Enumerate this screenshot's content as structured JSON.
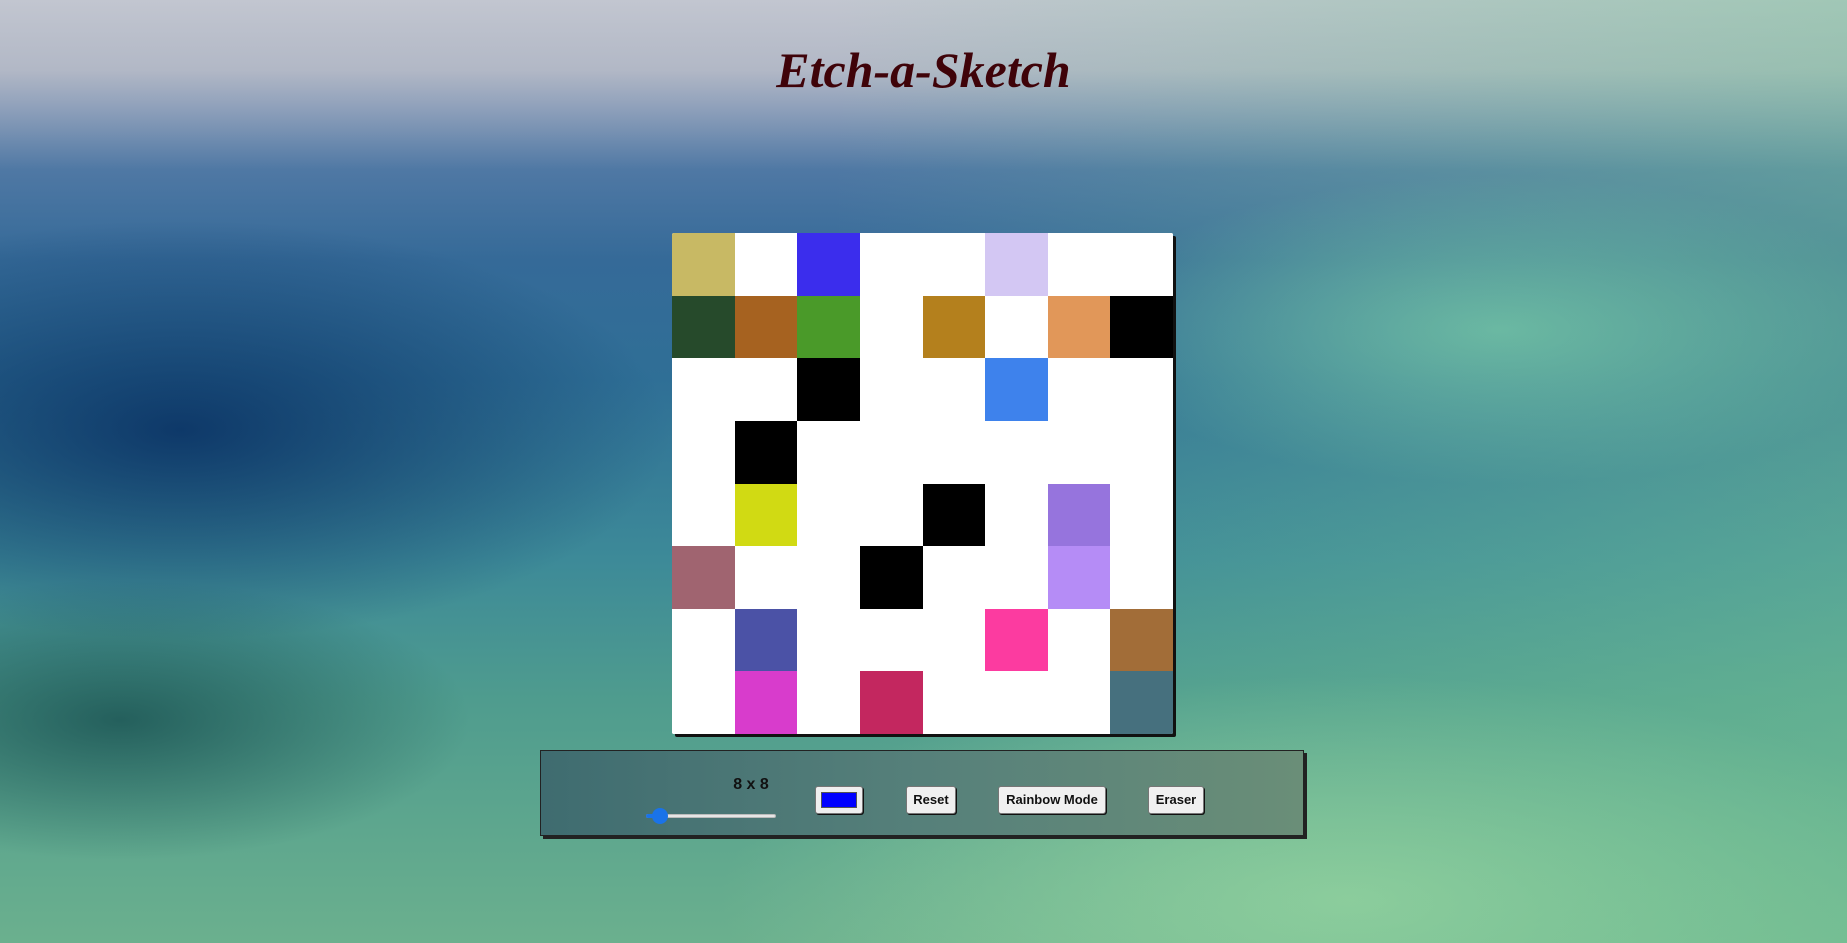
{
  "app": {
    "title": "Etch-a-Sketch"
  },
  "board": {
    "grid_size": 8,
    "background": "#ffffff",
    "cells": [
      [
        "#c8b964",
        "#ffffff",
        "#3b2ded",
        "#ffffff",
        "#ffffff",
        "#d3c7f3",
        "#ffffff",
        "#ffffff"
      ],
      [
        "#264a2b",
        "#a66220",
        "#4a9a29",
        "#ffffff",
        "#b4801d",
        "#ffffff",
        "#e19759",
        "#000000"
      ],
      [
        "#ffffff",
        "#ffffff",
        "#000000",
        "#ffffff",
        "#ffffff",
        "#3e82ec",
        "#ffffff",
        "#ffffff"
      ],
      [
        "#ffffff",
        "#000000",
        "#ffffff",
        "#ffffff",
        "#ffffff",
        "#ffffff",
        "#ffffff",
        "#ffffff"
      ],
      [
        "#ffffff",
        "#d1da13",
        "#ffffff",
        "#ffffff",
        "#000000",
        "#ffffff",
        "#9674dd",
        "#ffffff"
      ],
      [
        "#a06470",
        "#ffffff",
        "#ffffff",
        "#000000",
        "#ffffff",
        "#ffffff",
        "#b58cf6",
        "#ffffff"
      ],
      [
        "#ffffff",
        "#4b52a6",
        "#ffffff",
        "#ffffff",
        "#ffffff",
        "#fc3ba0",
        "#ffffff",
        "#a26d38"
      ],
      [
        "#ffffff",
        "#d83ccc",
        "#ffffff",
        "#c3275f",
        "#ffffff",
        "#ffffff",
        "#ffffff",
        "#46707e"
      ]
    ]
  },
  "controls": {
    "size_label": "8 x 8",
    "slider": {
      "min": 1,
      "max": 64,
      "value": 8
    },
    "color_picker": {
      "value": "#0000ff"
    },
    "reset_label": "Reset",
    "rainbow_label": "Rainbow Mode",
    "eraser_label": "Eraser"
  },
  "colors": {
    "title": "#3f0309",
    "slider_accent": "#1a73e8"
  }
}
